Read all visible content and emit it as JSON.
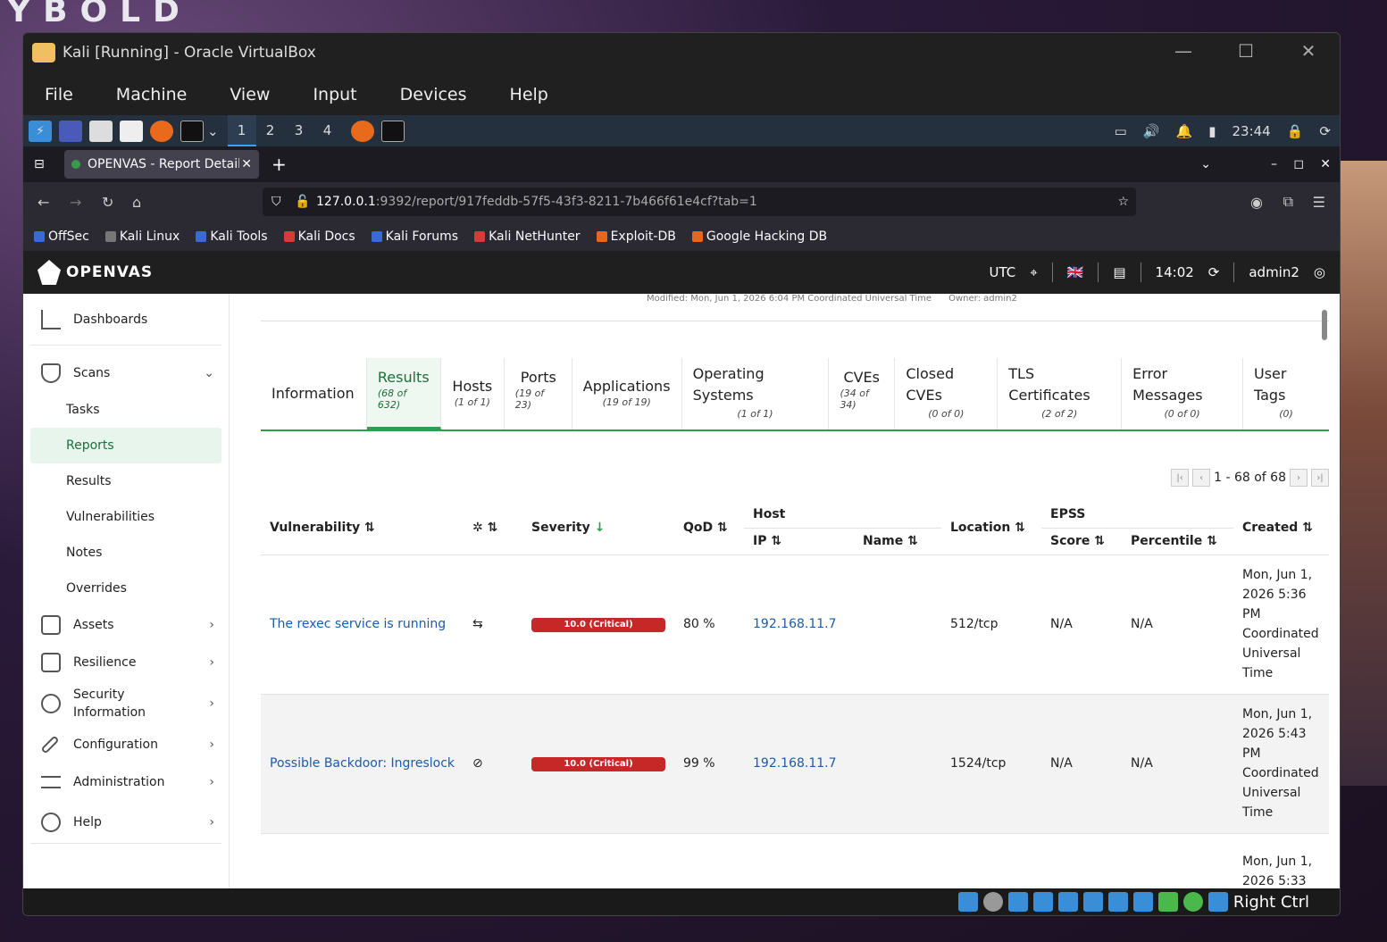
{
  "desktop": {
    "bg_text": "YBOLD"
  },
  "window": {
    "title": "Kali [Running] - Oracle VirtualBox"
  },
  "menu": [
    "File",
    "Machine",
    "View",
    "Input",
    "Devices",
    "Help"
  ],
  "kali_panel": {
    "workspaces": [
      "1",
      "2",
      "3",
      "4"
    ],
    "clock": "23:44"
  },
  "browser": {
    "tab_title": "OPENVAS - Report Details",
    "url_host": "127.0.0.1",
    "url_rest": ":9392/report/917feddb-57f5-43f3-8211-7b466f61e4cf?tab=1",
    "bookmarks": [
      "OffSec",
      "Kali Linux",
      "Kali Tools",
      "Kali Docs",
      "Kali Forums",
      "Kali NetHunter",
      "Exploit-DB",
      "Google Hacking DB"
    ]
  },
  "openvas": {
    "logo": "OPENVAS",
    "timezone": "UTC",
    "time": "14:02",
    "user": "admin2"
  },
  "sidebar": {
    "dashboards": "Dashboards",
    "scans": "Scans",
    "scans_sub": [
      "Tasks",
      "Reports",
      "Results",
      "Vulnerabilities",
      "Notes",
      "Overrides"
    ],
    "assets": "Assets",
    "resilience": "Resilience",
    "security_info": "Security Information",
    "configuration": "Configuration",
    "administration": "Administration",
    "help": "Help"
  },
  "report": {
    "modified": "Modified: Mon, Jun 1, 2026 6:04 PM Coordinated Universal Time",
    "owner": "Owner: admin2",
    "tabs": [
      {
        "label": "Information",
        "count": ""
      },
      {
        "label": "Results",
        "count": "(68 of 632)"
      },
      {
        "label": "Hosts",
        "count": "(1 of 1)"
      },
      {
        "label": "Ports",
        "count": "(19 of 23)"
      },
      {
        "label": "Applications",
        "count": "(19 of 19)"
      },
      {
        "label": "Operating Systems",
        "count": "(1 of 1)"
      },
      {
        "label": "CVEs",
        "count": "(34 of 34)"
      },
      {
        "label": "Closed CVEs",
        "count": "(0 of 0)"
      },
      {
        "label": "TLS Certificates",
        "count": "(2 of 2)"
      },
      {
        "label": "Error Messages",
        "count": "(0 of 0)"
      },
      {
        "label": "User Tags",
        "count": "(0)"
      }
    ],
    "pager": "1 - 68 of 68",
    "columns": {
      "vulnerability": "Vulnerability",
      "severity": "Severity",
      "qod": "QoD",
      "host": "Host",
      "ip": "IP",
      "name": "Name",
      "location": "Location",
      "epss": "EPSS",
      "score": "Score",
      "percentile": "Percentile",
      "created": "Created"
    },
    "rows": [
      {
        "vuln": "The rexec service is running",
        "severity": "10.0 (Critical)",
        "qod": "80 %",
        "ip": "192.168.11.7",
        "name": "",
        "location": "512/tcp",
        "score": "N/A",
        "percentile": "N/A",
        "created": "Mon, Jun 1, 2026 5:36 PM Coordinated Universal Time"
      },
      {
        "vuln": "Possible Backdoor: Ingreslock",
        "severity": "10.0 (Critical)",
        "qod": "99 %",
        "ip": "192.168.11.7",
        "name": "",
        "location": "1524/tcp",
        "score": "N/A",
        "percentile": "N/A",
        "created": "Mon, Jun 1, 2026 5:43 PM Coordinated Universal Time"
      },
      {
        "created": "Mon, Jun 1, 2026 5:33"
      }
    ]
  },
  "vbox_status": {
    "host_key": "Right Ctrl"
  }
}
